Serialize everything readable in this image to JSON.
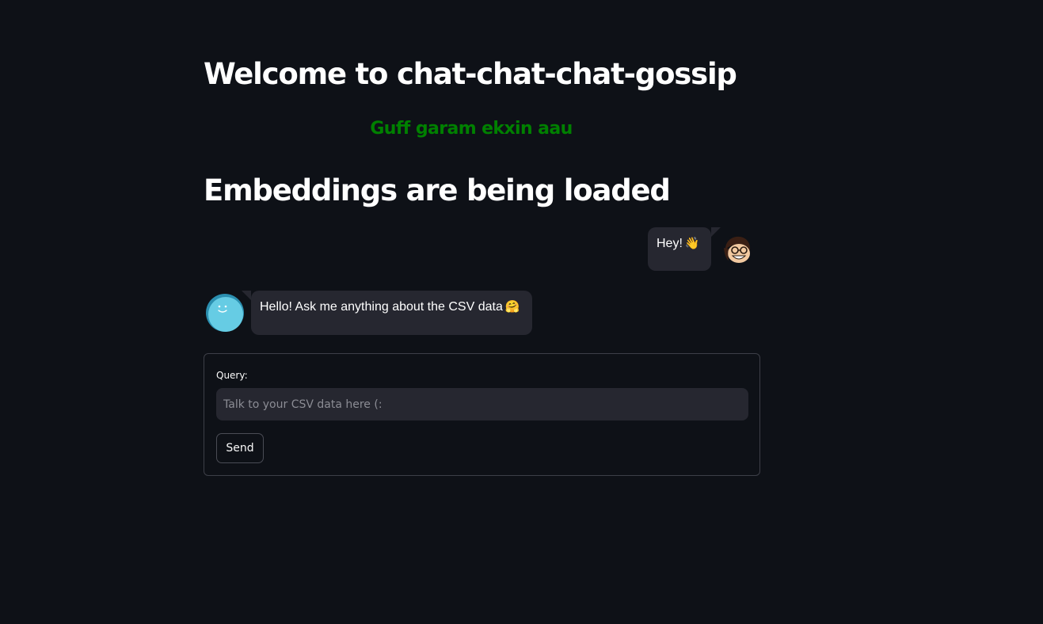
{
  "page": {
    "title": "Welcome to chat-chat-chat-gossip",
    "subtitle": "Guff garam ekxin aau",
    "status_heading": "Embeddings are being loaded"
  },
  "chat": {
    "messages": [
      {
        "role": "user",
        "text": "Hey!",
        "emoji": "👋",
        "avatar": "cartoon-person-avatar-icon"
      },
      {
        "role": "assistant",
        "text": "Hello! Ask me anything about the CSV data",
        "emoji": "🤗",
        "avatar": "blue-smiley-avatar-icon"
      }
    ]
  },
  "form": {
    "label": "Query:",
    "input_value": "",
    "placeholder": "Talk to your CSV data here (:",
    "submit_label": "Send"
  },
  "colors": {
    "background": "#0e1117",
    "bubble": "#262730",
    "subtitle": "#008000",
    "bot_avatar": "#66cce4"
  }
}
